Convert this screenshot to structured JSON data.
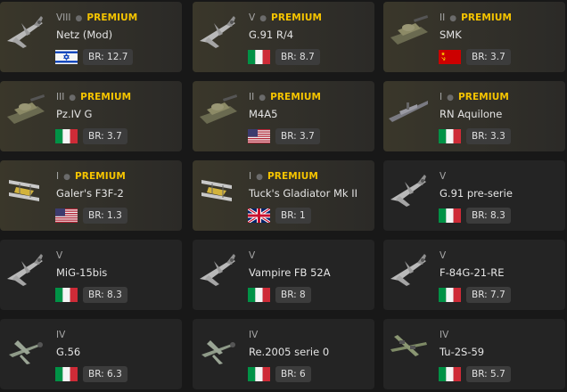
{
  "vehicles": [
    {
      "rank": "VIII",
      "premium_label": "PREMIUM",
      "name": "Netz (Mod)",
      "br": "BR: 12.7",
      "flag": "israel-flag",
      "icon": "jet-fighter-icon"
    },
    {
      "rank": "V",
      "premium_label": "PREMIUM",
      "name": "G.91 R/4",
      "br": "BR: 8.7",
      "flag": "italy-flag",
      "icon": "jet-fighter-icon"
    },
    {
      "rank": "II",
      "premium_label": "PREMIUM",
      "name": "SMK",
      "br": "BR: 3.7",
      "flag": "ussr-flag",
      "icon": "tank-icon"
    },
    {
      "rank": "III",
      "premium_label": "PREMIUM",
      "name": "Pz.IV G",
      "br": "BR: 3.7",
      "flag": "italy-flag",
      "icon": "tank-icon"
    },
    {
      "rank": "II",
      "premium_label": "PREMIUM",
      "name": "M4A5",
      "br": "BR: 3.7",
      "flag": "usa-flag",
      "icon": "tank-icon"
    },
    {
      "rank": "I",
      "premium_label": "PREMIUM",
      "name": "RN Aquilone",
      "br": "BR: 3.3",
      "flag": "italy-flag",
      "icon": "boat-icon"
    },
    {
      "rank": "I",
      "premium_label": "PREMIUM",
      "name": "Galer's F3F-2",
      "br": "BR: 1.3",
      "flag": "usa-flag",
      "icon": "biplane-icon"
    },
    {
      "rank": "I",
      "premium_label": "PREMIUM",
      "name": "Tuck's Gladiator Mk II",
      "br": "BR: 1",
      "flag": "uk-flag",
      "icon": "biplane-icon"
    },
    {
      "rank": "V",
      "premium_label": "",
      "name": "G.91 pre-serie",
      "br": "BR: 8.3",
      "flag": "italy-flag",
      "icon": "jet-fighter-icon"
    },
    {
      "rank": "V",
      "premium_label": "",
      "name": "MiG-15bis",
      "br": "BR: 8.3",
      "flag": "italy-flag",
      "icon": "jet-fighter-icon"
    },
    {
      "rank": "V",
      "premium_label": "",
      "name": "Vampire FB 52A",
      "br": "BR: 8",
      "flag": "italy-flag",
      "icon": "jet-fighter-icon"
    },
    {
      "rank": "V",
      "premium_label": "",
      "name": "F-84G-21-RE",
      "br": "BR: 7.7",
      "flag": "italy-flag",
      "icon": "jet-fighter-icon"
    },
    {
      "rank": "IV",
      "premium_label": "",
      "name": "G.56",
      "br": "BR: 6.3",
      "flag": "italy-flag",
      "icon": "prop-fighter-icon"
    },
    {
      "rank": "IV",
      "premium_label": "",
      "name": "Re.2005 serie 0",
      "br": "BR: 6",
      "flag": "italy-flag",
      "icon": "prop-fighter-icon"
    },
    {
      "rank": "IV",
      "premium_label": "",
      "name": "Tu-2S-59",
      "br": "BR: 5.7",
      "flag": "italy-flag",
      "icon": "bomber-icon"
    }
  ],
  "colors": {
    "premium_text": "#f5c400",
    "premium_card_bg": "#3a372a",
    "regular_card_bg": "#242424",
    "page_bg": "#181818",
    "br_badge_bg": "#3c3c3c"
  }
}
